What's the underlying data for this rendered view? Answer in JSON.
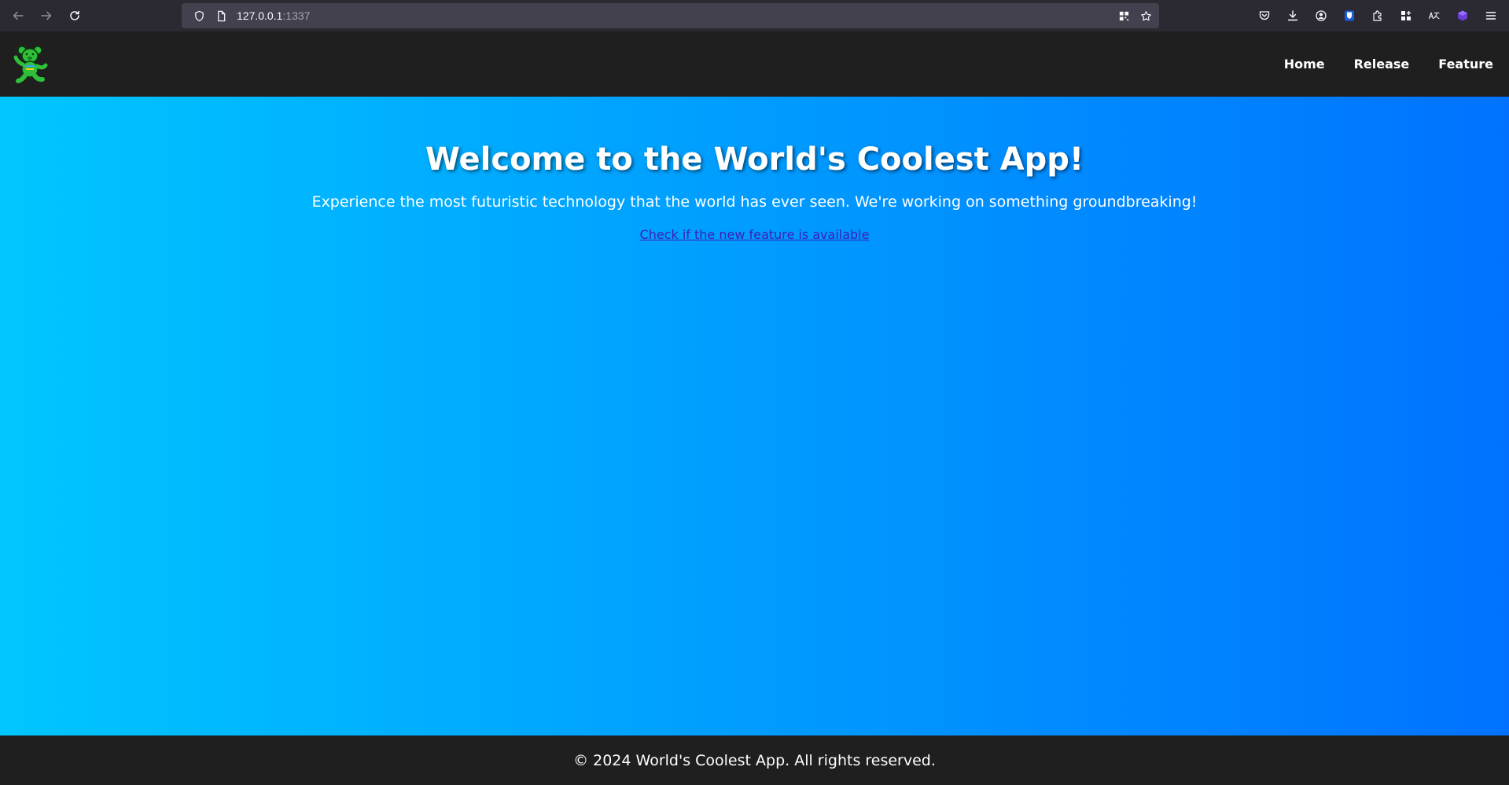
{
  "browser": {
    "url_host": "127.0.0.1",
    "url_port": ":1337"
  },
  "header": {
    "logo_icon": "dancing-bear-logo",
    "nav": [
      {
        "label": "Home"
      },
      {
        "label": "Release"
      },
      {
        "label": "Feature"
      }
    ]
  },
  "hero": {
    "title": "Welcome to the World's Coolest App!",
    "subtitle": "Experience the most futuristic technology that the world has ever seen. We're working on something groundbreaking!",
    "link_text": "Check if the new feature is available",
    "gradient_start": "#00c6ff",
    "gradient_end": "#0072ff",
    "link_color": "#3b1fb8"
  },
  "footer": {
    "text": "© 2024 World's Coolest App. All rights reserved."
  },
  "colors": {
    "header_bg": "#1f1f1f",
    "browser_bg": "#2b2a33"
  }
}
